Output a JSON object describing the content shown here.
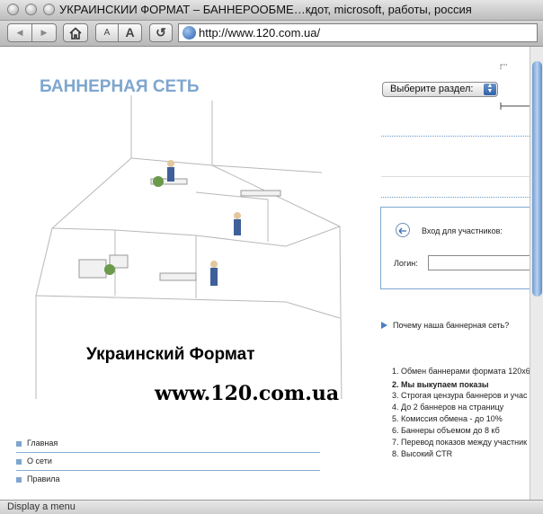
{
  "window": {
    "title": "УКРАИНСКИИ ФОРМАТ – БАННЕРООБМЕ…кдот, microsoft, работы, россия"
  },
  "toolbar": {
    "back_glyph": "◀",
    "forward_glyph": "▶",
    "text_smaller": "A",
    "text_larger": "A",
    "reload_glyph": "↺",
    "url": "http://www.120.com.ua/"
  },
  "page": {
    "heading": "БАННЕРНАЯ СЕТЬ",
    "brand_name": "Украинский Формат",
    "brand_url": "www.120.com.ua",
    "section_select": "Выберите раздел:",
    "login_title": "Вход для участников:",
    "login_label": "Логин:",
    "why_link": "Почему наша баннерная сеть?",
    "features": [
      "1. Обмен баннерами формата 120х6",
      "2. Мы выкупаем показы",
      "3. Строгая цензура баннеров и учас",
      "4. До 2 баннеров на страницу",
      "5. Комиссия обмена - до 10%",
      "6. Баннеры объемом до 8 кб",
      "7. Перевод показов между участник",
      "8. Высокий CTR"
    ],
    "nav": [
      "Главная",
      "О сети",
      "Правила"
    ]
  },
  "status": {
    "text": "Display a menu"
  },
  "colors": {
    "heading_blue": "#7ea6cf",
    "accent_blue": "#4a7fc0"
  }
}
